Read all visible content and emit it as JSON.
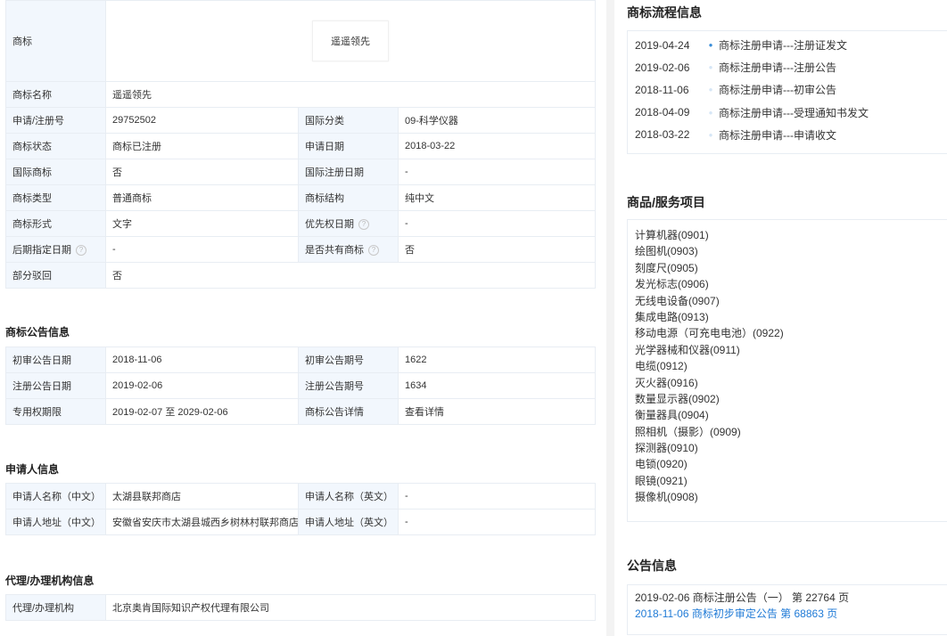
{
  "basic": {
    "trademark_label": "商标",
    "trademark_logo_text": "遥遥领先",
    "rows": [
      {
        "l1": "商标名称",
        "v1": "遥遥领先"
      },
      {
        "l1": "申请/注册号",
        "v1": "29752502",
        "l2": "国际分类",
        "v2": "09-科学仪器"
      },
      {
        "l1": "商标状态",
        "v1": "商标已注册",
        "l2": "申请日期",
        "v2": "2018-03-22"
      },
      {
        "l1": "国际商标",
        "v1": "否",
        "l2": "国际注册日期",
        "v2": "-"
      },
      {
        "l1": "商标类型",
        "v1": "普通商标",
        "l2": "商标结构",
        "v2": "纯中文"
      },
      {
        "l1": "商标形式",
        "v1": "文字",
        "l2": "优先权日期",
        "v2": "-"
      },
      {
        "l1": "后期指定日期",
        "v1": "-",
        "l2": "是否共有商标",
        "v2": "否"
      },
      {
        "l1": "部分驳回",
        "v1": "否"
      }
    ]
  },
  "announcement": {
    "title": "商标公告信息",
    "rows": [
      {
        "l1": "初审公告日期",
        "v1": "2018-11-06",
        "l2": "初审公告期号",
        "v2": "1622"
      },
      {
        "l1": "注册公告日期",
        "v1": "2019-02-06",
        "l2": "注册公告期号",
        "v2": "1634"
      },
      {
        "l1": "专用权期限",
        "v1": "2019-02-07 至 2029-02-06",
        "l2": "商标公告详情",
        "v2": "查看详情"
      }
    ]
  },
  "applicant": {
    "title": "申请人信息",
    "rows": [
      {
        "l1": "申请人名称（中文）",
        "v1": "太湖县联邦商店",
        "l2": "申请人名称（英文）",
        "v2": "-"
      },
      {
        "l1": "申请人地址（中文）",
        "v1": "安徽省安庆市太湖县城西乡树林村联邦商店",
        "l2": "申请人地址（英文）",
        "v2": "-"
      }
    ]
  },
  "agency": {
    "title": "代理/办理机构信息",
    "label": "代理/办理机构",
    "value": "北京奥肯国际知识产权代理有限公司"
  },
  "flow": {
    "title": "商标流程信息",
    "items": [
      {
        "date": "2019-04-24",
        "text": "商标注册申请---注册证发文"
      },
      {
        "date": "2019-02-06",
        "text": "商标注册申请---注册公告"
      },
      {
        "date": "2018-11-06",
        "text": "商标注册申请---初审公告"
      },
      {
        "date": "2018-04-09",
        "text": "商标注册申请---受理通知书发文"
      },
      {
        "date": "2018-03-22",
        "text": "商标注册申请---申请收文"
      }
    ]
  },
  "goods": {
    "title": "商品/服务项目",
    "items": [
      "计算机器(0901)",
      "绘图机(0903)",
      "刻度尺(0905)",
      "发光标志(0906)",
      "无线电设备(0907)",
      "集成电路(0913)",
      "移动电源（可充电电池）(0922)",
      "光学器械和仪器(0911)",
      "电缆(0912)",
      "灭火器(0916)",
      "数量显示器(0902)",
      "衡量器具(0904)",
      "照相机（摄影）(0909)",
      "探测器(0910)",
      "电锁(0920)",
      "眼镜(0921)",
      "摄像机(0908)"
    ]
  },
  "notices": {
    "title": "公告信息",
    "items": [
      {
        "text": "2019-02-06 商标注册公告（一） 第 22764 页"
      },
      {
        "text": "2018-11-06 商标初步审定公告 第 68863 页"
      }
    ]
  },
  "colors": {
    "accent": "#1f7ad6",
    "label_bg": "#f2f7fd",
    "border": "#e8edf3"
  }
}
